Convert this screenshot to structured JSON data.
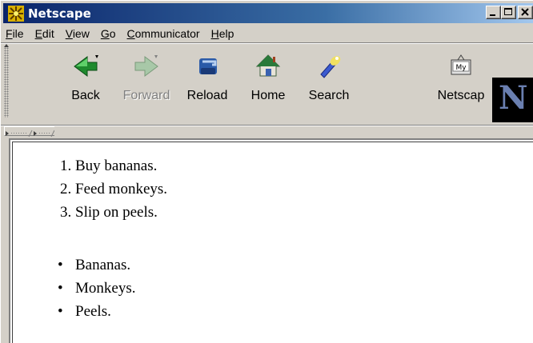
{
  "window": {
    "title": "Netscape"
  },
  "menu": [
    {
      "label_u": "F",
      "label_rest": "ile"
    },
    {
      "label_u": "E",
      "label_rest": "dit"
    },
    {
      "label_u": "V",
      "label_rest": "iew"
    },
    {
      "label_u": "G",
      "label_rest": "o"
    },
    {
      "label_u": "C",
      "label_rest": "ommunicator"
    },
    {
      "label_u": "H",
      "label_rest": "elp"
    }
  ],
  "toolbar": {
    "back": "Back",
    "forward": "Forward",
    "reload": "Reload",
    "home": "Home",
    "search": "Search",
    "netscape": "Netscap",
    "logo_letter": "N"
  },
  "content": {
    "ordered": [
      "Buy bananas.",
      "Feed monkeys.",
      "Slip on peels."
    ],
    "unordered": [
      "Bananas.",
      "Monkeys.",
      "Peels."
    ],
    "bullet": "•"
  },
  "colors": {
    "title_gradient_start": "#0a246a",
    "title_gradient_end": "#a6caf0",
    "chrome": "#d4d0c8"
  }
}
